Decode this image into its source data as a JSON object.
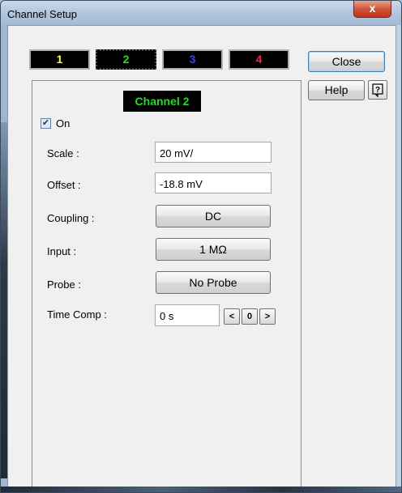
{
  "window": {
    "title": "Channel Setup",
    "close_glyph": "x"
  },
  "channel_tabs": [
    {
      "label": "1",
      "color": "#ffff33"
    },
    {
      "label": "2",
      "color": "#22dd22"
    },
    {
      "label": "3",
      "color": "#3344ff"
    },
    {
      "label": "4",
      "color": "#ff2244"
    }
  ],
  "buttons": {
    "close": "Close",
    "help": "Help"
  },
  "panel": {
    "title": "Channel 2",
    "on_label": "On",
    "on_checked": true,
    "scale_label": "Scale :",
    "scale_value": "20 mV/",
    "offset_label": "Offset :",
    "offset_value": "-18.8 mV",
    "coupling_label": "Coupling :",
    "coupling_value": "DC",
    "input_label": "Input :",
    "input_value": "1 MΩ",
    "probe_label": "Probe :",
    "probe_value": "No Probe",
    "timecomp_label": "Time Comp :",
    "timecomp_value": "0 s",
    "step_left": "<",
    "step_zero": "0",
    "step_right": ">"
  },
  "icons": [
    "close-icon",
    "context-help-icon",
    "checkmark-icon"
  ]
}
